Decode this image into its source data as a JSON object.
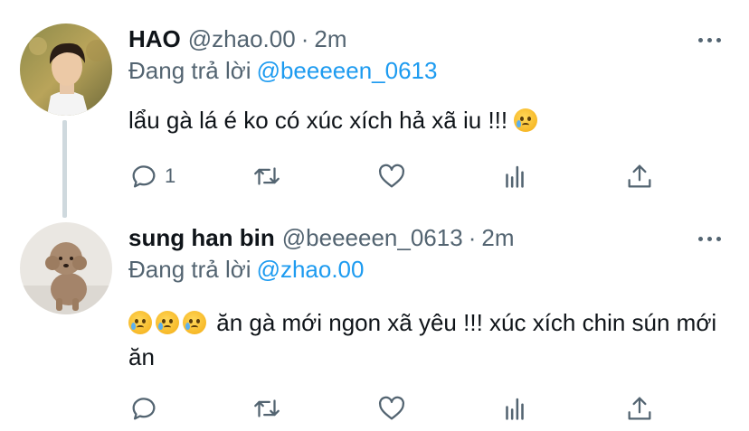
{
  "tweets": [
    {
      "display_name": "HAO",
      "handle": "@zhao.00",
      "separator": "·",
      "time": "2m",
      "replying_prefix": "Đang trả lời",
      "replying_to": "@beeeeen_0613",
      "text": "lẩu gà lá é ko có xúc xích hả xã iu !!!",
      "emojis_after": [
        "crying-face"
      ],
      "reply_count": "1",
      "avatar": "profile-photo-person"
    },
    {
      "display_name": "sung han bin",
      "handle": "@beeeeen_0613",
      "separator": "·",
      "time": "2m",
      "replying_prefix": "Đang trả lời",
      "replying_to": "@zhao.00",
      "emojis_before": [
        "crying-face",
        "crying-face",
        "crying-face"
      ],
      "text": "ăn gà mới ngon xã yêu !!! xúc xích chin sún mới ăn",
      "reply_count": "",
      "avatar": "profile-photo-dog"
    }
  ],
  "icons": {
    "reply": "comment-icon",
    "retweet": "retweet-icon",
    "like": "heart-icon",
    "analytics": "analytics-icon",
    "share": "share-icon",
    "more": "more-options-icon"
  },
  "colors": {
    "link": "#1d9bf0",
    "muted": "#536471",
    "text": "#0f1419",
    "thread_line": "#cfd9de"
  }
}
